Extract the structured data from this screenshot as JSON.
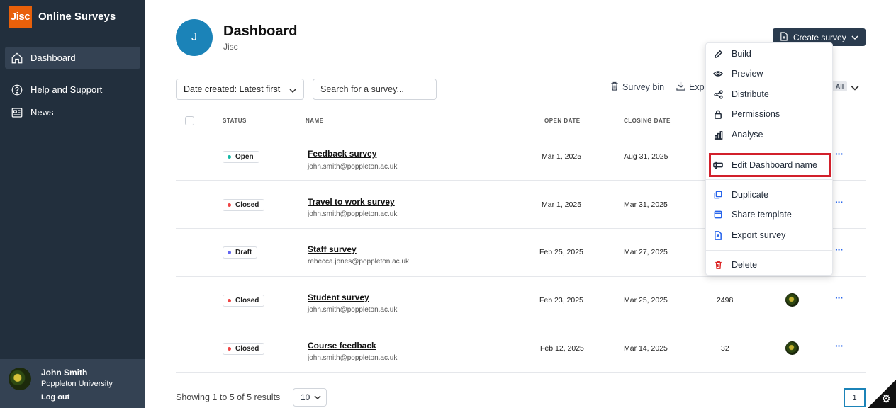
{
  "app": {
    "logo_text": "Jisc",
    "name": "Online Surveys"
  },
  "sidebar": {
    "items": [
      {
        "label": "Dashboard",
        "icon": "home-icon",
        "active": true
      },
      {
        "label": "Help and Support",
        "icon": "help-circle-icon",
        "active": false
      },
      {
        "label": "News",
        "icon": "news-icon",
        "active": false
      }
    ],
    "user": {
      "name": "John Smith",
      "org": "Poppleton University",
      "logout": "Log out"
    }
  },
  "header": {
    "avatar_letter": "J",
    "title": "Dashboard",
    "subtitle": "Jisc",
    "create_button": "Create survey"
  },
  "toolbar": {
    "sort_label": "Date created: Latest first",
    "search_placeholder": "Search for a survey...",
    "survey_bin": "Survey bin",
    "export": "Expo",
    "filter_badge": "All"
  },
  "table": {
    "headers": {
      "status": "STATUS",
      "name": "NAME",
      "open_date": "OPEN DATE",
      "closing_date": "CLOSING DATE"
    },
    "rows": [
      {
        "status": "Open",
        "status_color": "#14b8a6",
        "name": "Feedback survey",
        "email": "john.smith@poppleton.ac.uk",
        "open_date": "Mar 1, 2025",
        "closing_date": "Aug 31, 2025",
        "responses": "",
        "owner": false
      },
      {
        "status": "Closed",
        "status_color": "#ef4444",
        "name": "Travel to work survey",
        "email": "john.smith@poppleton.ac.uk",
        "open_date": "Mar 1, 2025",
        "closing_date": "Mar 31, 2025",
        "responses": "",
        "owner": false
      },
      {
        "status": "Draft",
        "status_color": "#6366f1",
        "name": "Staff survey",
        "email": "rebecca.jones@poppleton.ac.uk",
        "open_date": "Feb 25, 2025",
        "closing_date": "Mar 27, 2025",
        "responses": "",
        "owner": false
      },
      {
        "status": "Closed",
        "status_color": "#ef4444",
        "name": "Student survey",
        "email": "john.smith@poppleton.ac.uk",
        "open_date": "Feb 23, 2025",
        "closing_date": "Mar 25, 2025",
        "responses": "2498",
        "owner": true
      },
      {
        "status": "Closed",
        "status_color": "#ef4444",
        "name": "Course feedback",
        "email": "john.smith@poppleton.ac.uk",
        "open_date": "Feb 12, 2025",
        "closing_date": "Mar 14, 2025",
        "responses": "32",
        "owner": true
      }
    ],
    "row_action": "···"
  },
  "footer": {
    "results_text": "Showing 1 to 5 of 5 results",
    "per_page": "10",
    "page": "1"
  },
  "menu": {
    "items": [
      {
        "label": "Build",
        "icon": "pencil-icon",
        "color": "#1f2937"
      },
      {
        "label": "Preview",
        "icon": "eye-icon",
        "color": "#1f2937"
      },
      {
        "label": "Distribute",
        "icon": "share-nodes-icon",
        "color": "#1f2937"
      },
      {
        "label": "Permissions",
        "icon": "lock-icon",
        "color": "#1f2937"
      },
      {
        "label": "Analyse",
        "icon": "bar-chart-icon",
        "color": "#1f2937"
      },
      {
        "label": "Edit Dashboard name",
        "icon": "rename-icon",
        "color": "#1f2937",
        "highlighted": true
      },
      {
        "label": "Duplicate",
        "icon": "copy-icon",
        "color": "#2563eb"
      },
      {
        "label": "Share template",
        "icon": "template-icon",
        "color": "#2563eb"
      },
      {
        "label": "Export survey",
        "icon": "export-file-icon",
        "color": "#2563eb"
      },
      {
        "label": "Delete",
        "icon": "trash-icon",
        "color": "#dc2626"
      }
    ]
  },
  "colors": {
    "sidebar_bg": "#222f3d",
    "brand_orange": "#e8600a",
    "primary_dark": "#2a3b4e",
    "avatar_blue": "#1b83b8",
    "highlight_red": "#d2202b"
  }
}
